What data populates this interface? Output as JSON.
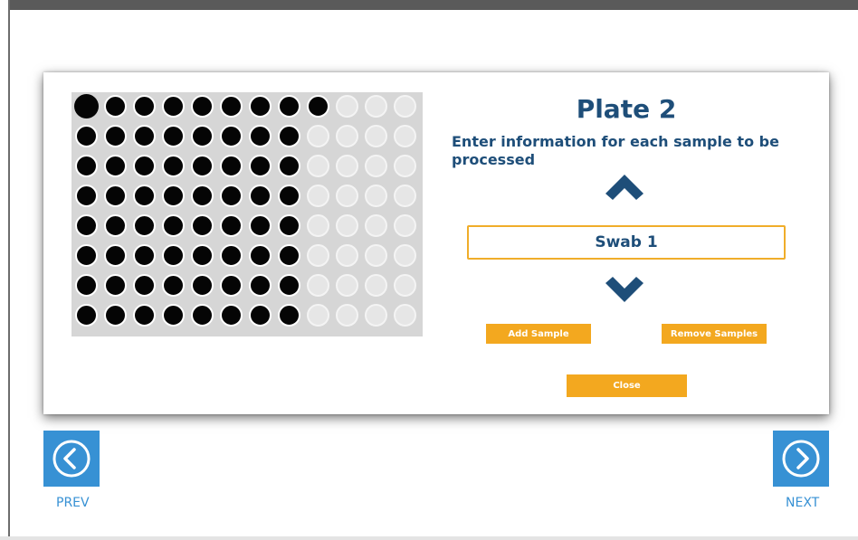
{
  "plate": {
    "rows": 8,
    "cols": 12,
    "filled_per_row": [
      9,
      8,
      8,
      8,
      8,
      8,
      8,
      8
    ],
    "selected_well": "row 1, col 1"
  },
  "header": {
    "title": "Plate 2",
    "instruction": "Enter information for each sample to be processed"
  },
  "sample": {
    "current_value": "Swab 1"
  },
  "buttons": {
    "add_sample": "Add Sample",
    "remove_samples": "Remove Samples",
    "close": "Close"
  },
  "nav": {
    "prev_label": "PREV",
    "next_label": "NEXT"
  },
  "colors": {
    "accent": "#f3a81f",
    "title": "#1e4e79",
    "nav": "#3791d4",
    "well_filled": "#050505",
    "well_empty": "#e6e6e6"
  },
  "icons": {
    "up": "chevron-up-icon",
    "down": "chevron-down-icon",
    "prev": "circle-left-icon",
    "next": "circle-right-icon"
  }
}
